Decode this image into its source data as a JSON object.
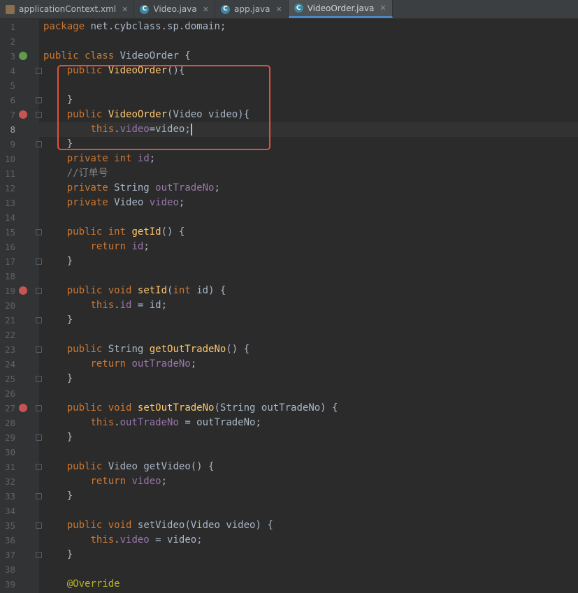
{
  "tabs": [
    {
      "label": "applicationContext.xml",
      "icon": "xml-file-icon",
      "active": false
    },
    {
      "label": "Video.java",
      "icon": "class-c-icon",
      "active": false
    },
    {
      "label": "app.java",
      "icon": "class-c-icon",
      "active": false
    },
    {
      "label": "VideoOrder.java",
      "icon": "class-c-icon",
      "active": true
    }
  ],
  "close_glyph": "✕",
  "editor": {
    "current_line": 8,
    "lines": [
      {
        "n": "1",
        "t": "package net.cybclass.sp.domain;"
      },
      {
        "n": "2",
        "t": ""
      },
      {
        "n": "3",
        "t": "public class VideoOrder {"
      },
      {
        "n": "4",
        "t": "    public VideoOrder(){"
      },
      {
        "n": "5",
        "t": ""
      },
      {
        "n": "6",
        "t": "    }"
      },
      {
        "n": "7",
        "t": "    public VideoOrder(Video video){"
      },
      {
        "n": "8",
        "t": "        this.video=video;"
      },
      {
        "n": "9",
        "t": "    }"
      },
      {
        "n": "10",
        "t": "    private int id;"
      },
      {
        "n": "11",
        "t": "    //订单号"
      },
      {
        "n": "12",
        "t": "    private String outTradeNo;"
      },
      {
        "n": "13",
        "t": "    private Video video;"
      },
      {
        "n": "14",
        "t": ""
      },
      {
        "n": "15",
        "t": "    public int getId() {"
      },
      {
        "n": "16",
        "t": "        return id;"
      },
      {
        "n": "17",
        "t": "    }"
      },
      {
        "n": "18",
        "t": ""
      },
      {
        "n": "19",
        "t": "    public void setId(int id) {"
      },
      {
        "n": "20",
        "t": "        this.id = id;"
      },
      {
        "n": "21",
        "t": "    }"
      },
      {
        "n": "22",
        "t": ""
      },
      {
        "n": "23",
        "t": "    public String getOutTradeNo() {"
      },
      {
        "n": "24",
        "t": "        return outTradeNo;"
      },
      {
        "n": "25",
        "t": "    }"
      },
      {
        "n": "26",
        "t": ""
      },
      {
        "n": "27",
        "t": "    public void setOutTradeNo(String outTradeNo) {"
      },
      {
        "n": "28",
        "t": "        this.outTradeNo = outTradeNo;"
      },
      {
        "n": "29",
        "t": "    }"
      },
      {
        "n": "30",
        "t": ""
      },
      {
        "n": "31",
        "t": "    public Video getVideo() {"
      },
      {
        "n": "32",
        "t": "        return video;"
      },
      {
        "n": "33",
        "t": "    }"
      },
      {
        "n": "34",
        "t": ""
      },
      {
        "n": "35",
        "t": "    public void setVideo(Video video) {"
      },
      {
        "n": "36",
        "t": "        this.video = video;"
      },
      {
        "n": "37",
        "t": "    }"
      },
      {
        "n": "38",
        "t": ""
      },
      {
        "n": "39",
        "t": "    @Override"
      }
    ]
  },
  "colors": {
    "keyword": "#cc7832",
    "method": "#ffc66d",
    "field": "#9876aa",
    "comment": "#808080",
    "annotation": "#bbb529",
    "highlight_box": "#e0503c"
  }
}
